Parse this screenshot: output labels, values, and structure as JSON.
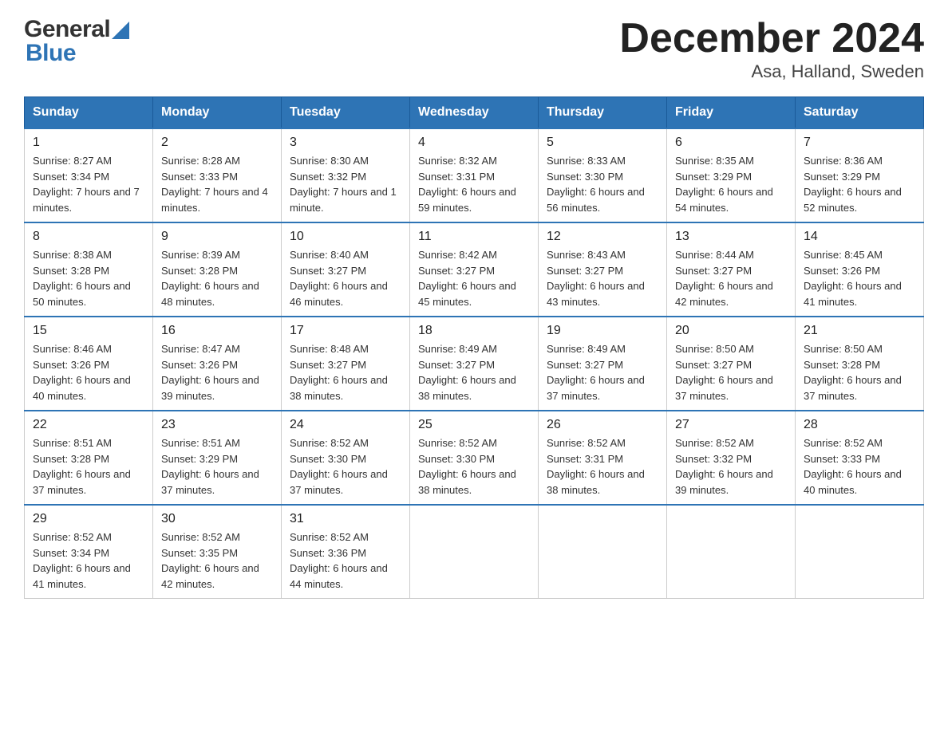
{
  "logo": {
    "general": "General",
    "blue": "Blue",
    "tagline": ""
  },
  "title": "December 2024",
  "subtitle": "Asa, Halland, Sweden",
  "days": [
    "Sunday",
    "Monday",
    "Tuesday",
    "Wednesday",
    "Thursday",
    "Friday",
    "Saturday"
  ],
  "weeks": [
    [
      {
        "date": "1",
        "sunrise": "8:27 AM",
        "sunset": "3:34 PM",
        "daylight": "7 hours and 7 minutes."
      },
      {
        "date": "2",
        "sunrise": "8:28 AM",
        "sunset": "3:33 PM",
        "daylight": "7 hours and 4 minutes."
      },
      {
        "date": "3",
        "sunrise": "8:30 AM",
        "sunset": "3:32 PM",
        "daylight": "7 hours and 1 minute."
      },
      {
        "date": "4",
        "sunrise": "8:32 AM",
        "sunset": "3:31 PM",
        "daylight": "6 hours and 59 minutes."
      },
      {
        "date": "5",
        "sunrise": "8:33 AM",
        "sunset": "3:30 PM",
        "daylight": "6 hours and 56 minutes."
      },
      {
        "date": "6",
        "sunrise": "8:35 AM",
        "sunset": "3:29 PM",
        "daylight": "6 hours and 54 minutes."
      },
      {
        "date": "7",
        "sunrise": "8:36 AM",
        "sunset": "3:29 PM",
        "daylight": "6 hours and 52 minutes."
      }
    ],
    [
      {
        "date": "8",
        "sunrise": "8:38 AM",
        "sunset": "3:28 PM",
        "daylight": "6 hours and 50 minutes."
      },
      {
        "date": "9",
        "sunrise": "8:39 AM",
        "sunset": "3:28 PM",
        "daylight": "6 hours and 48 minutes."
      },
      {
        "date": "10",
        "sunrise": "8:40 AM",
        "sunset": "3:27 PM",
        "daylight": "6 hours and 46 minutes."
      },
      {
        "date": "11",
        "sunrise": "8:42 AM",
        "sunset": "3:27 PM",
        "daylight": "6 hours and 45 minutes."
      },
      {
        "date": "12",
        "sunrise": "8:43 AM",
        "sunset": "3:27 PM",
        "daylight": "6 hours and 43 minutes."
      },
      {
        "date": "13",
        "sunrise": "8:44 AM",
        "sunset": "3:27 PM",
        "daylight": "6 hours and 42 minutes."
      },
      {
        "date": "14",
        "sunrise": "8:45 AM",
        "sunset": "3:26 PM",
        "daylight": "6 hours and 41 minutes."
      }
    ],
    [
      {
        "date": "15",
        "sunrise": "8:46 AM",
        "sunset": "3:26 PM",
        "daylight": "6 hours and 40 minutes."
      },
      {
        "date": "16",
        "sunrise": "8:47 AM",
        "sunset": "3:26 PM",
        "daylight": "6 hours and 39 minutes."
      },
      {
        "date": "17",
        "sunrise": "8:48 AM",
        "sunset": "3:27 PM",
        "daylight": "6 hours and 38 minutes."
      },
      {
        "date": "18",
        "sunrise": "8:49 AM",
        "sunset": "3:27 PM",
        "daylight": "6 hours and 38 minutes."
      },
      {
        "date": "19",
        "sunrise": "8:49 AM",
        "sunset": "3:27 PM",
        "daylight": "6 hours and 37 minutes."
      },
      {
        "date": "20",
        "sunrise": "8:50 AM",
        "sunset": "3:27 PM",
        "daylight": "6 hours and 37 minutes."
      },
      {
        "date": "21",
        "sunrise": "8:50 AM",
        "sunset": "3:28 PM",
        "daylight": "6 hours and 37 minutes."
      }
    ],
    [
      {
        "date": "22",
        "sunrise": "8:51 AM",
        "sunset": "3:28 PM",
        "daylight": "6 hours and 37 minutes."
      },
      {
        "date": "23",
        "sunrise": "8:51 AM",
        "sunset": "3:29 PM",
        "daylight": "6 hours and 37 minutes."
      },
      {
        "date": "24",
        "sunrise": "8:52 AM",
        "sunset": "3:30 PM",
        "daylight": "6 hours and 37 minutes."
      },
      {
        "date": "25",
        "sunrise": "8:52 AM",
        "sunset": "3:30 PM",
        "daylight": "6 hours and 38 minutes."
      },
      {
        "date": "26",
        "sunrise": "8:52 AM",
        "sunset": "3:31 PM",
        "daylight": "6 hours and 38 minutes."
      },
      {
        "date": "27",
        "sunrise": "8:52 AM",
        "sunset": "3:32 PM",
        "daylight": "6 hours and 39 minutes."
      },
      {
        "date": "28",
        "sunrise": "8:52 AM",
        "sunset": "3:33 PM",
        "daylight": "6 hours and 40 minutes."
      }
    ],
    [
      {
        "date": "29",
        "sunrise": "8:52 AM",
        "sunset": "3:34 PM",
        "daylight": "6 hours and 41 minutes."
      },
      {
        "date": "30",
        "sunrise": "8:52 AM",
        "sunset": "3:35 PM",
        "daylight": "6 hours and 42 minutes."
      },
      {
        "date": "31",
        "sunrise": "8:52 AM",
        "sunset": "3:36 PM",
        "daylight": "6 hours and 44 minutes."
      },
      {
        "date": "",
        "sunrise": "",
        "sunset": "",
        "daylight": ""
      },
      {
        "date": "",
        "sunrise": "",
        "sunset": "",
        "daylight": ""
      },
      {
        "date": "",
        "sunrise": "",
        "sunset": "",
        "daylight": ""
      },
      {
        "date": "",
        "sunrise": "",
        "sunset": "",
        "daylight": ""
      }
    ]
  ]
}
